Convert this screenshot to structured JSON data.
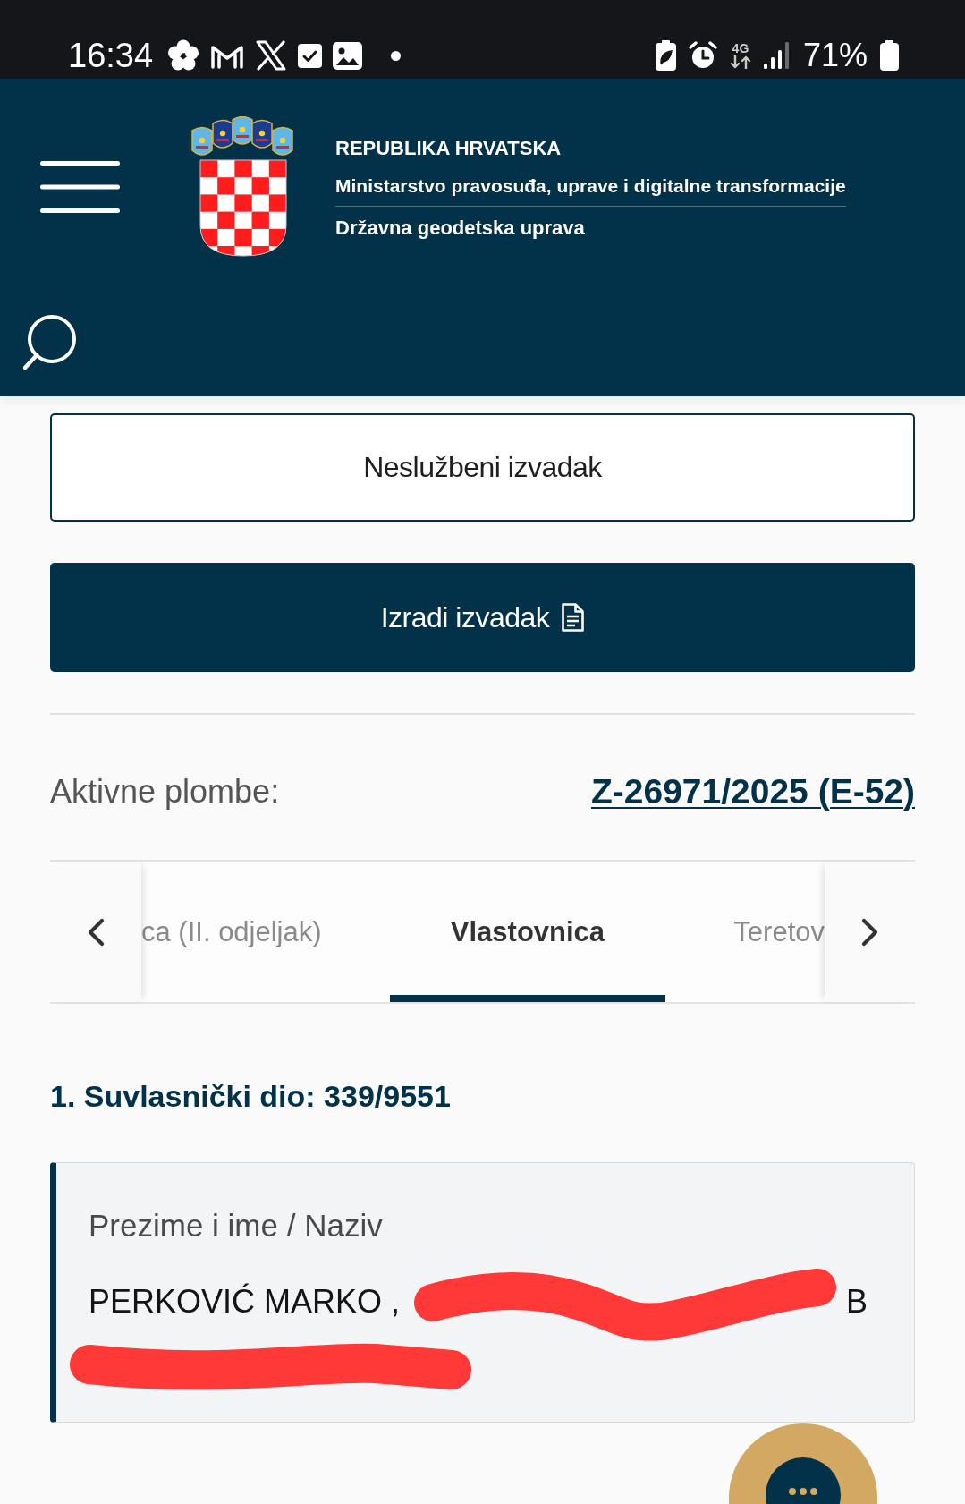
{
  "status_bar": {
    "time": "16:34",
    "network": "4G",
    "battery": "71%"
  },
  "header": {
    "title": "REPUBLIKA HRVATSKA",
    "ministry": "Ministarstvo pravosuđa, uprave i digitalne transformacije",
    "agency": "Državna geodetska uprava"
  },
  "actions": [
    {
      "label": "Neslužbeni izvadak",
      "kind": "outline"
    },
    {
      "label": "Izradi izvadak",
      "kind": "primary"
    }
  ],
  "seals": {
    "label": "Aktivne plombe:",
    "link": "Z-26971/2025 (E-52)"
  },
  "tabs": [
    {
      "label": "ca (II. odjeljak)",
      "selected": false
    },
    {
      "label": "Vlastovnica",
      "selected": true
    },
    {
      "label": "Teretov",
      "selected": false
    }
  ],
  "share": {
    "heading": "1. Suvlasnički dio: 339/9551",
    "field_label": "Prezime i ime / Naziv",
    "value": "PERKOVIĆ MARKO ,",
    "value_tail": "B"
  }
}
